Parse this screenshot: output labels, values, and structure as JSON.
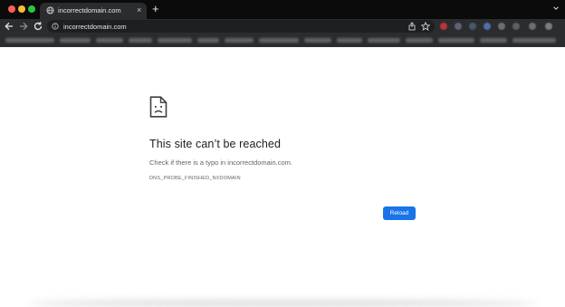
{
  "window": {
    "traffic_lights": [
      "close",
      "minimize",
      "zoom"
    ]
  },
  "tab": {
    "title": "incorrectdomain.com",
    "close_label": "×",
    "favicon": "globe-icon"
  },
  "new_tab_label": "+",
  "toolbar": {
    "url": "incorrectdomain.com",
    "back_icon": "arrow-left-icon",
    "forward_icon": "arrow-right-icon",
    "reload_icon": "reload-icon",
    "share_icon": "share-icon",
    "star_icon": "star-icon"
  },
  "extension_colors": [
    "#c0323a",
    "#5c6478",
    "#49566e",
    "#4f6fb0",
    "#6a6f78",
    "#5b5f66",
    "#6b6e73",
    "#7a7c80"
  ],
  "error_page": {
    "icon": "sad-document-icon",
    "title": "This site can’t be reached",
    "message": "Check if there is a typo in incorrectdomain.com.",
    "code": "DNS_PROBE_FINISHED_NXDOMAIN",
    "reload_label": "Reload",
    "accent_color": "#1a73e8"
  }
}
